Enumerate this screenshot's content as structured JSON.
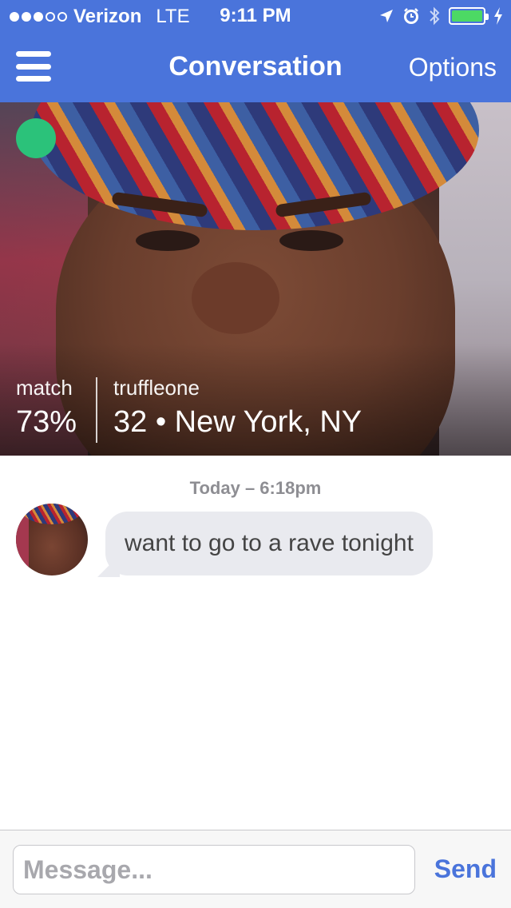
{
  "status_bar": {
    "carrier": "Verizon",
    "network": "LTE",
    "time": "9:11 PM",
    "signal_bars_filled": 3,
    "signal_bars_total": 5,
    "icons": [
      "location-arrow-icon",
      "alarm-icon",
      "bluetooth-icon",
      "battery-icon",
      "charging-icon"
    ],
    "battery_level": 1.0
  },
  "nav": {
    "title": "Conversation",
    "options_label": "Options",
    "menu_icon": "hamburger-icon"
  },
  "profile": {
    "online": true,
    "online_color": "#2bc27a",
    "match_label": "match",
    "match_value": "73%",
    "username": "truffleone",
    "details": "32 • New York, NY"
  },
  "conversation": {
    "timestamp": "Today – 6:18pm",
    "messages": [
      {
        "sender": "truffleone",
        "text": "want to go to a rave tonight"
      }
    ]
  },
  "composer": {
    "placeholder": "Message...",
    "value": "",
    "send_label": "Send"
  },
  "colors": {
    "accent": "#4a74db",
    "bubble": "#e9eaef"
  }
}
